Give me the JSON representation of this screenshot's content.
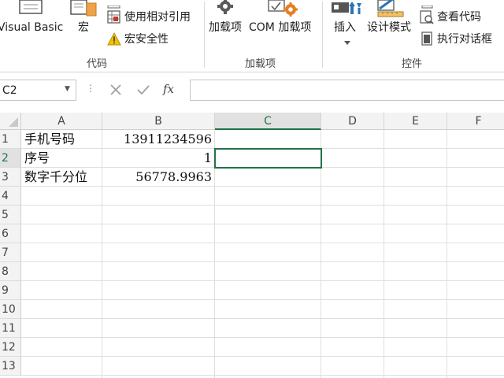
{
  "ribbon": {
    "code_group": {
      "label": "代码",
      "visual_basic": "Visual Basic",
      "macros": "宏",
      "use_relative_refs": "使用相对引用",
      "macro_security": "宏安全性"
    },
    "addins_group": {
      "label": "加载项",
      "addins": "加载项",
      "com_addins": "COM 加载项"
    },
    "controls_group": {
      "label": "控件",
      "insert": "插入",
      "design_mode": "设计模式",
      "view_code": "查看代码",
      "run_dialog": "执行对话框"
    }
  },
  "formula_bar": {
    "name_box": "C2",
    "formula": ""
  },
  "sheet": {
    "columns": [
      "A",
      "B",
      "C",
      "D",
      "E",
      "F"
    ],
    "rows": [
      "1",
      "2",
      "3",
      "4",
      "5",
      "6",
      "7",
      "8",
      "9",
      "10",
      "11",
      "12",
      "13"
    ],
    "selected_column": "C",
    "selected_row": "2",
    "cells": {
      "A1": "手机号码",
      "B1": "13911234596",
      "A2": "序号",
      "B2": "1",
      "A3": "数字千分位",
      "B3": "56778.9963"
    }
  },
  "colors": {
    "accent": "#217346",
    "header_bg": "#f3f3f3",
    "gridline": "#dfdfdf"
  }
}
